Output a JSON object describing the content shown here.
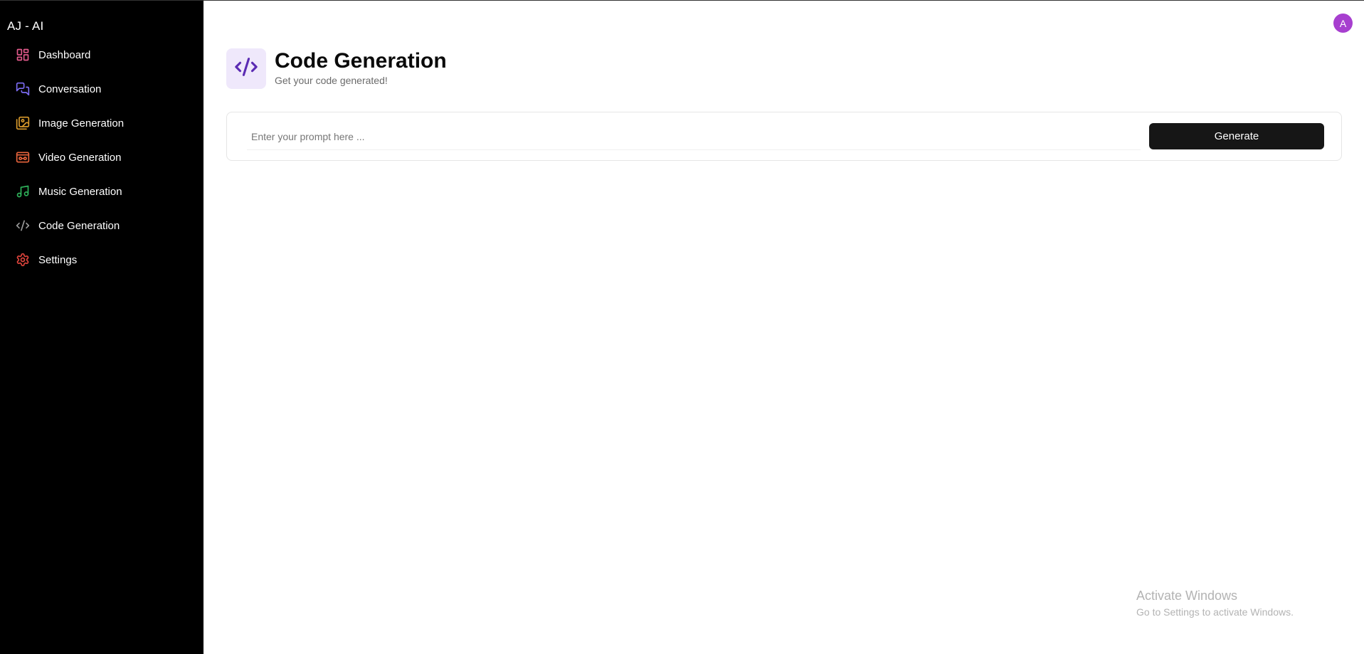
{
  "app": {
    "brand": "AJ - AI"
  },
  "sidebar": {
    "items": [
      {
        "label": "Dashboard",
        "icon": "dashboard-icon",
        "color": "#e25a8c"
      },
      {
        "label": "Conversation",
        "icon": "chat-icon",
        "color": "#7c6cf2"
      },
      {
        "label": "Image Generation",
        "icon": "image-icon",
        "color": "#d99a2b"
      },
      {
        "label": "Video Generation",
        "icon": "video-icon",
        "color": "#e8643c"
      },
      {
        "label": "Music Generation",
        "icon": "music-icon",
        "color": "#2fb35b"
      },
      {
        "label": "Code Generation",
        "icon": "code-icon",
        "color": "#9a9a9a"
      },
      {
        "label": "Settings",
        "icon": "gear-icon",
        "color": "#e0443c"
      }
    ]
  },
  "user": {
    "avatar_initial": "A",
    "avatar_color": "#a73fcf"
  },
  "page": {
    "title": "Code Generation",
    "subtitle": "Get your code generated!",
    "icon": "code-icon",
    "icon_color": "#5b2bb3",
    "icon_bg": "#efe8fb"
  },
  "prompt": {
    "placeholder": "Enter your prompt here ...",
    "value": "",
    "button_label": "Generate"
  },
  "watermark": {
    "line1": "Activate Windows",
    "line2": "Go to Settings to activate Windows."
  }
}
